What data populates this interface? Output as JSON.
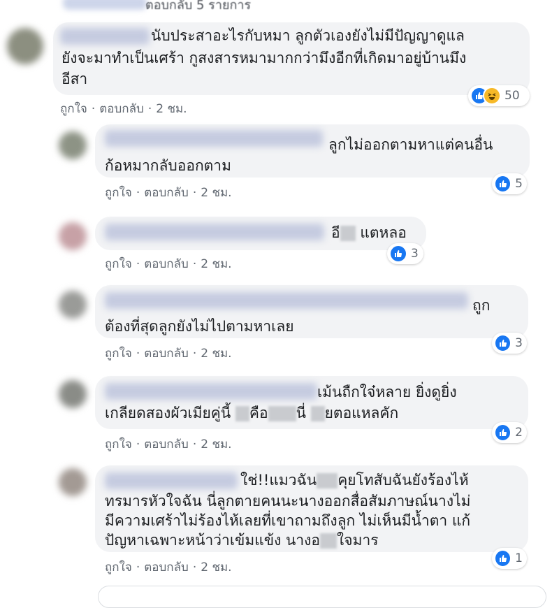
{
  "top": {
    "replies_link": "ตอบกลับ 5 รายการ"
  },
  "common": {
    "like": "ถูกใจ",
    "reply": "ตอบกลับ",
    "time": "2 ชม.",
    "separator": "·"
  },
  "comments": [
    {
      "lines": [
        "นับประสาอะไรกับหมา ลูกตัวเองยังไม่มีปัญญาดูแล",
        "ยังจะมาทำเป็นเศร้า กูสงสารหมามากกว่ามึงอีกที่เกิดมาอยู่บ้านมึง",
        "อีสา"
      ],
      "reaction_count": "50"
    },
    {
      "lines": [
        "ลูกไม่ออกตามหาแต่คนอื่น",
        "ก้อหมากลับออกตาม"
      ],
      "reaction_count": "5"
    },
    {
      "lines": [
        "อี",
        "แตหลอ"
      ],
      "reaction_count": "3"
    },
    {
      "lines": [
        "ถูก",
        "ต้องที่สุดลูกยังไม่ไปตามหาเลย"
      ],
      "reaction_count": "3"
    },
    {
      "lines": [
        "เม้นถืกใจ๋หลาย ยิ่งดูยิ่ง",
        "เกลียดสองผัวเมียคู่นี้",
        "คือ",
        "นี่",
        "ยตอแหลคัก"
      ],
      "reaction_count": "2"
    },
    {
      "lines": [
        "ใช่!!แมวฉัน",
        "คุยโทสับฉันยังร้องไห้",
        "ทรมารหัวใจฉัน นี่ลูกตายคนนะนางออกสื่อสัมภาษณ์นางไม่",
        "มีความเศร้าไม่ร้องไห้เลยที่เขาถามถึงลูก ไม่เห็นมีน้ำตา แก้",
        "ปัญหาเฉพาะหน้าว่าเข้มแข้ง นางอ",
        "ใจมาร"
      ],
      "reaction_count": "1"
    }
  ]
}
